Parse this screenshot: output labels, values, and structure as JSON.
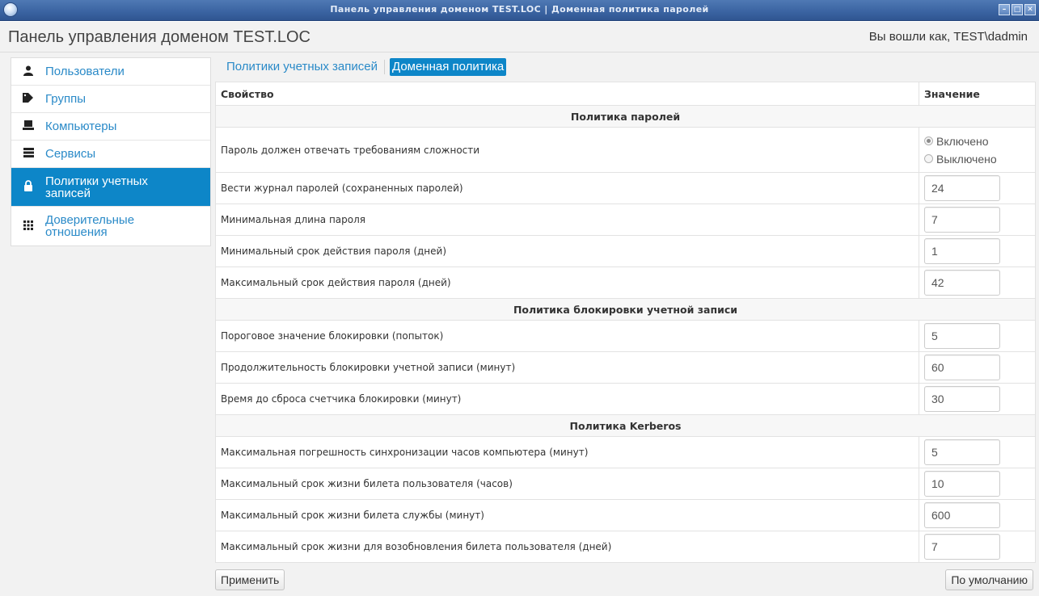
{
  "window": {
    "title": "Панель управления доменом TEST.LOC | Доменная политика паролей",
    "buttons": [
      "–",
      "□",
      "✕"
    ]
  },
  "header": {
    "app_title": "Панель управления доменом TEST.LOC",
    "user_info": "Вы вошли как, TEST\\dadmin"
  },
  "sidebar": {
    "items": [
      {
        "label": "Пользователи",
        "icon": "user-icon",
        "active": false
      },
      {
        "label": "Группы",
        "icon": "tag-icon",
        "active": false
      },
      {
        "label": "Компьютеры",
        "icon": "computer-icon",
        "active": false
      },
      {
        "label": "Сервисы",
        "icon": "server-icon",
        "active": false
      },
      {
        "label": "Политики учетных записей",
        "icon": "lock-icon",
        "active": true
      },
      {
        "label": "Доверительные отношения",
        "icon": "grid-icon",
        "active": false
      }
    ]
  },
  "tabs": [
    {
      "label": "Политики учетных записей",
      "active": false
    },
    {
      "label": "Доменная политика",
      "active": true
    }
  ],
  "table": {
    "col_property": "Свойство",
    "col_value": "Значение",
    "sections": [
      {
        "title": "Политика паролей",
        "complexity": {
          "label": "Пароль должен отвечать требованиям сложности",
          "option_on": "Включено",
          "option_off": "Выключено",
          "selected": "on"
        },
        "rows": [
          {
            "label": "Вести журнал паролей (сохраненных паролей)",
            "value": "24"
          },
          {
            "label": "Минимальная длина пароля",
            "value": "7"
          },
          {
            "label": "Минимальный срок действия пароля (дней)",
            "value": "1"
          },
          {
            "label": "Максимальный срок действия пароля (дней)",
            "value": "42"
          }
        ]
      },
      {
        "title": "Политика блокировки учетной записи",
        "rows": [
          {
            "label": "Пороговое значение блокировки (попыток)",
            "value": "5"
          },
          {
            "label": "Продолжительность блокировки учетной записи (минут)",
            "value": "60"
          },
          {
            "label": "Время до сброса счетчика блокировки (минут)",
            "value": "30"
          }
        ]
      },
      {
        "title": "Политика Kerberos",
        "rows": [
          {
            "label": "Максимальная погрешность синхронизации часов компьютера (минут)",
            "value": "5"
          },
          {
            "label": "Максимальный срок жизни билета пользователя (часов)",
            "value": "10"
          },
          {
            "label": "Максимальный срок жизни билета службы (минут)",
            "value": "600"
          },
          {
            "label": "Максимальный срок жизни для возобновления билета пользователя (дней)",
            "value": "7"
          }
        ]
      }
    ]
  },
  "actions": {
    "apply_label": "Применить",
    "defaults_label": "По умолчанию"
  },
  "colors": {
    "accent": "#0d86c8",
    "link": "#2a8ac8",
    "titlebar": "#3a63a1"
  }
}
